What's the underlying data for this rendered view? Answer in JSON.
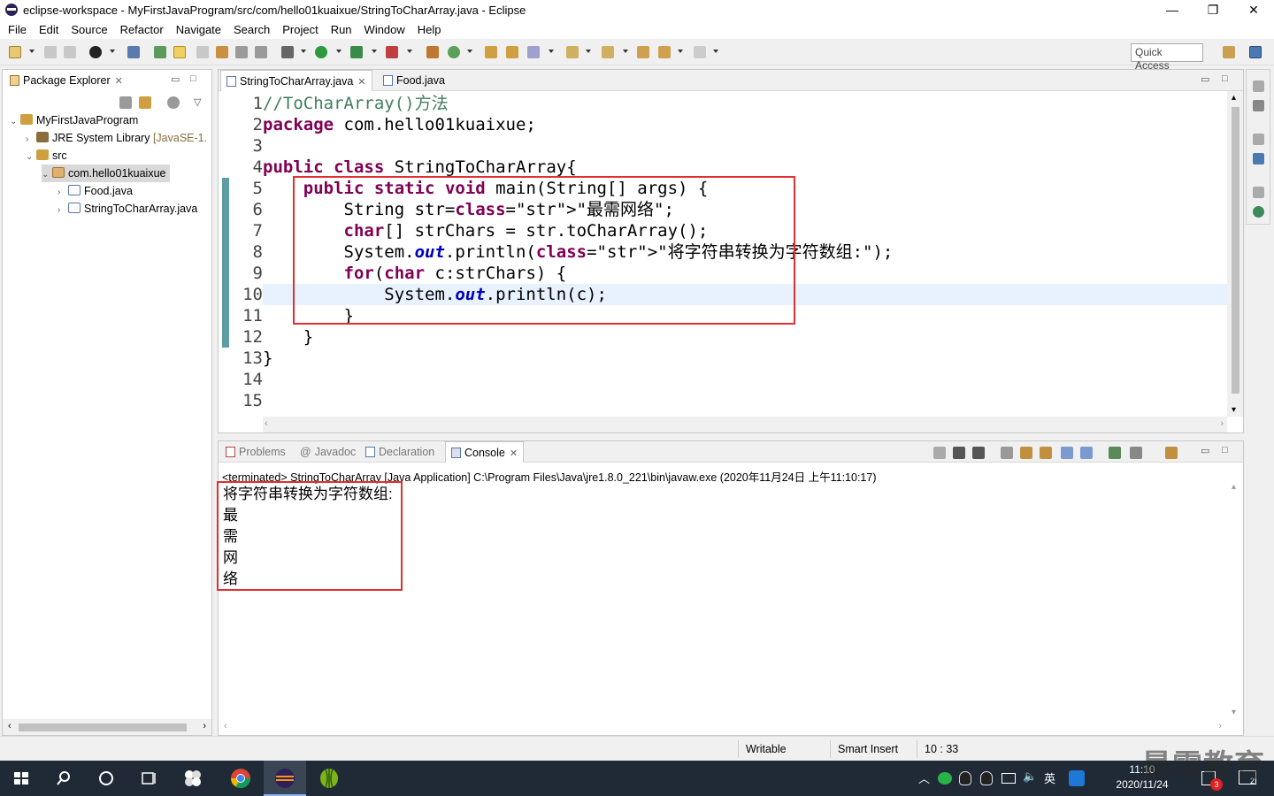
{
  "window": {
    "title": "eclipse-workspace - MyFirstJavaProgram/src/com/hello01kuaixue/StringToCharArray.java - Eclipse",
    "controls": [
      "—",
      "❐",
      "✕"
    ]
  },
  "menu": [
    "File",
    "Edit",
    "Source",
    "Refactor",
    "Navigate",
    "Search",
    "Project",
    "Run",
    "Window",
    "Help"
  ],
  "toolbar": {
    "quick_access": "Quick Access"
  },
  "package_explorer": {
    "tab_label": "Package Explorer",
    "tree": [
      {
        "label": "MyFirstJavaProgram",
        "depth": 0,
        "twisty": "⌄"
      },
      {
        "label": "JRE System Library",
        "suffix": "[JavaSE-1.",
        "depth": 1,
        "twisty": "›"
      },
      {
        "label": "src",
        "depth": 1,
        "twisty": "⌄"
      },
      {
        "label": "com.hello01kuaixue",
        "depth": 2,
        "twisty": "⌄",
        "selected": true
      },
      {
        "label": "Food.java",
        "depth": 3,
        "twisty": "›"
      },
      {
        "label": "StringToCharArray.java",
        "depth": 3,
        "twisty": "›"
      }
    ]
  },
  "editor": {
    "tabs": [
      {
        "label": "StringToCharArray.java",
        "active": true
      },
      {
        "label": "Food.java",
        "active": false
      }
    ],
    "lines": [
      {
        "n": "1",
        "text": "//ToCharArray()方法"
      },
      {
        "n": "2",
        "text": "package com.hello01kuaixue;"
      },
      {
        "n": "3",
        "text": ""
      },
      {
        "n": "4",
        "text": "public class StringToCharArray{"
      },
      {
        "n": "5",
        "text": "    public static void main(String[] args) {"
      },
      {
        "n": "6",
        "text": "        String str=\"最需网络\";"
      },
      {
        "n": "7",
        "text": "        char[] strChars = str.toCharArray();"
      },
      {
        "n": "8",
        "text": "        System.out.println(\"将字符串转换为字符数组:\");"
      },
      {
        "n": "9",
        "text": "        for(char c:strChars) {"
      },
      {
        "n": "10",
        "text": "            System.out.println(c);"
      },
      {
        "n": "11",
        "text": "        }"
      },
      {
        "n": "12",
        "text": "    }"
      },
      {
        "n": "13",
        "text": "}"
      },
      {
        "n": "14",
        "text": ""
      },
      {
        "n": "15",
        "text": ""
      }
    ]
  },
  "bottom": {
    "tabs": [
      {
        "label": "Problems",
        "active": false
      },
      {
        "label": "Javadoc",
        "active": false
      },
      {
        "label": "Declaration",
        "active": false
      },
      {
        "label": "Console",
        "active": true
      }
    ],
    "terminated": "<terminated> StringToCharArray [Java Application] C:\\Program Files\\Java\\jre1.8.0_221\\bin\\javaw.exe (2020年11月24日 上午11:10:17)",
    "output": [
      "将字符串转换为字符数组:",
      "最",
      "需",
      "网",
      "络"
    ]
  },
  "status": {
    "writable": "Writable",
    "insert_mode": "Smart Insert",
    "position": "10 : 33"
  },
  "taskbar": {
    "time": "11:10",
    "date": "2020/11/24",
    "ime": "英",
    "badge": "3",
    "notif": "2"
  },
  "watermark": "最需教育"
}
